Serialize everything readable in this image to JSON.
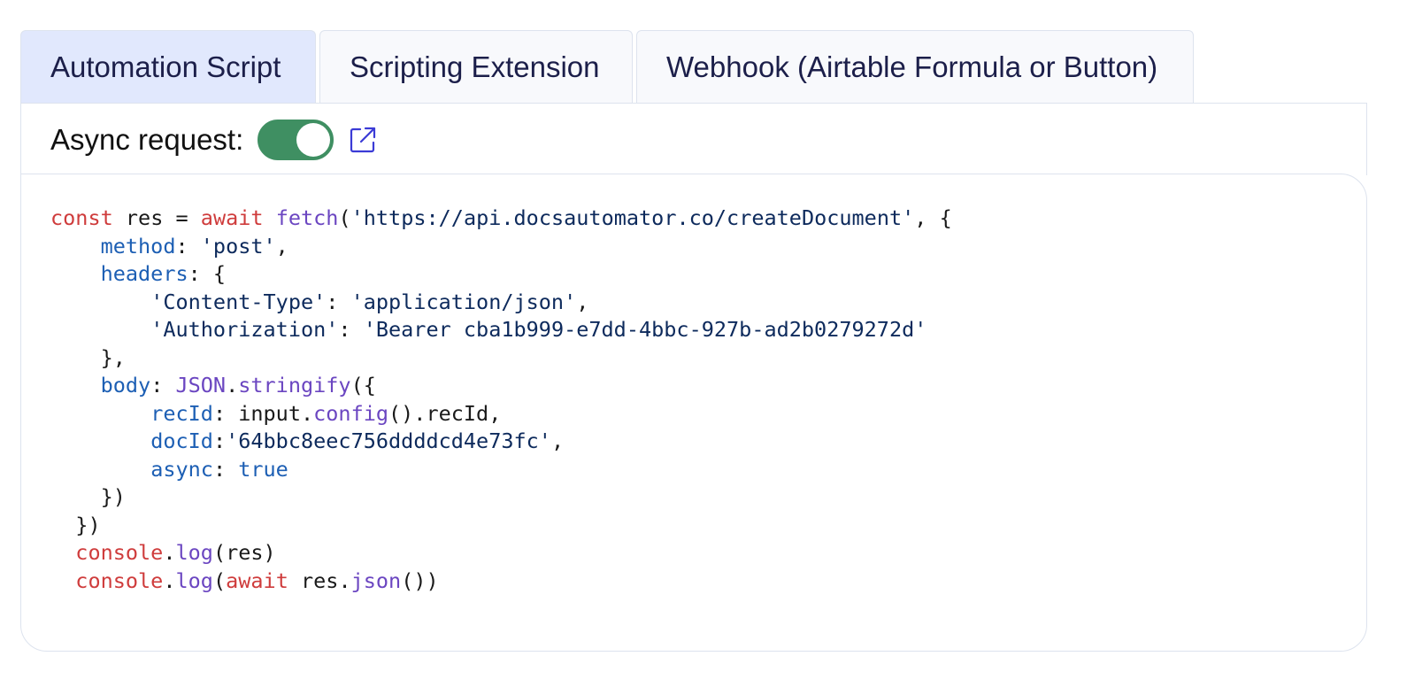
{
  "tabs": [
    {
      "label": "Automation Script",
      "active": true
    },
    {
      "label": "Scripting Extension",
      "active": false
    },
    {
      "label": "Webhook (Airtable Formula or Button)",
      "active": false
    }
  ],
  "toolbar": {
    "async_label": "Async request:",
    "async_enabled": true,
    "external_link_icon": "external-link-icon"
  },
  "code": {
    "t_const": "const",
    "t_res": " res = ",
    "t_await": "await",
    "t_fetch": "fetch",
    "t_url": "'https://api.docsautomator.co/createDocument'",
    "t_method_key": "method",
    "t_method_val": "'post'",
    "t_headers_key": "headers",
    "t_ct_key": "'Content-Type'",
    "t_ct_val": "'application/json'",
    "t_auth_key": "'Authorization'",
    "t_auth_val": "'Bearer cba1b999-e7dd-4bbc-927b-ad2b0279272d'",
    "t_body_key": "body",
    "t_json": "JSON",
    "t_stringify": "stringify",
    "t_recid_key": "recId",
    "t_input": "input.",
    "t_config": "config",
    "t_recid_tail": "().recId,",
    "t_docid_key": "docId",
    "t_docid_val": "'64bbc8eec756ddddcd4e73fc'",
    "t_async_key": "async",
    "t_true": "true",
    "t_console": "console",
    "t_log": "log",
    "t_res_arg": "(res)",
    "t_await2": "await",
    "t_res_dot": " res.",
    "t_json_fn": "json",
    "t_close": "())"
  },
  "colors": {
    "active_tab": "#e1e8fd",
    "toggle_on": "#3f8f62",
    "keyword": "#cf3c3c",
    "function": "#6b46c1",
    "property": "#1d5fb4",
    "string": "#0d2a5c",
    "link_icon": "#3b3bd6"
  }
}
